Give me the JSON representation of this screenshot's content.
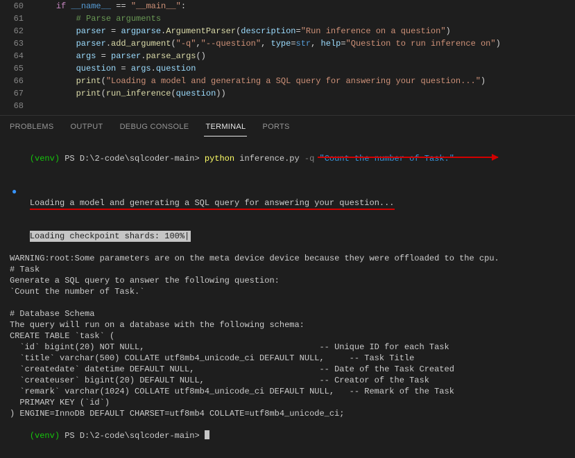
{
  "editor": {
    "lines": [
      {
        "num": "60",
        "indent": 1,
        "tokens": [
          [
            "keyword",
            "if"
          ],
          [
            "plain",
            " "
          ],
          [
            "builtin",
            "__name__"
          ],
          [
            "plain",
            " "
          ],
          [
            "operator",
            "=="
          ],
          [
            "plain",
            " "
          ],
          [
            "string",
            "\"__main__\""
          ],
          [
            "plain",
            ":"
          ]
        ]
      },
      {
        "num": "61",
        "indent": 2,
        "tokens": [
          [
            "comment",
            "# Parse arguments"
          ]
        ]
      },
      {
        "num": "62",
        "indent": 2,
        "tokens": [
          [
            "variable",
            "parser"
          ],
          [
            "plain",
            " "
          ],
          [
            "operator",
            "="
          ],
          [
            "plain",
            " "
          ],
          [
            "variable",
            "argparse"
          ],
          [
            "plain",
            "."
          ],
          [
            "function",
            "ArgumentParser"
          ],
          [
            "paren",
            "("
          ],
          [
            "variable",
            "description"
          ],
          [
            "operator",
            "="
          ],
          [
            "string",
            "\"Run inference on a question\""
          ],
          [
            "paren",
            ")"
          ]
        ]
      },
      {
        "num": "63",
        "indent": 2,
        "tokens": [
          [
            "variable",
            "parser"
          ],
          [
            "plain",
            "."
          ],
          [
            "function",
            "add_argument"
          ],
          [
            "paren",
            "("
          ],
          [
            "string",
            "\"-q\""
          ],
          [
            "plain",
            ","
          ],
          [
            "string",
            "\"--question\""
          ],
          [
            "plain",
            ", "
          ],
          [
            "variable",
            "type"
          ],
          [
            "operator",
            "="
          ],
          [
            "builtin",
            "str"
          ],
          [
            "plain",
            ", "
          ],
          [
            "variable",
            "help"
          ],
          [
            "operator",
            "="
          ],
          [
            "string",
            "\"Question to run inference on\""
          ],
          [
            "paren",
            ")"
          ]
        ]
      },
      {
        "num": "64",
        "indent": 2,
        "tokens": [
          [
            "variable",
            "args"
          ],
          [
            "plain",
            " "
          ],
          [
            "operator",
            "="
          ],
          [
            "plain",
            " "
          ],
          [
            "variable",
            "parser"
          ],
          [
            "plain",
            "."
          ],
          [
            "function",
            "parse_args"
          ],
          [
            "paren",
            "()"
          ]
        ]
      },
      {
        "num": "65",
        "indent": 2,
        "tokens": [
          [
            "variable",
            "question"
          ],
          [
            "plain",
            " "
          ],
          [
            "operator",
            "="
          ],
          [
            "plain",
            " "
          ],
          [
            "variable",
            "args"
          ],
          [
            "plain",
            "."
          ],
          [
            "variable",
            "question"
          ]
        ]
      },
      {
        "num": "66",
        "indent": 2,
        "tokens": [
          [
            "function",
            "print"
          ],
          [
            "paren",
            "("
          ],
          [
            "string",
            "\"Loading a model and generating a SQL query for answering your question...\""
          ],
          [
            "paren",
            ")"
          ]
        ]
      },
      {
        "num": "67",
        "indent": 2,
        "tokens": [
          [
            "function",
            "print"
          ],
          [
            "paren",
            "("
          ],
          [
            "function",
            "run_inference"
          ],
          [
            "paren",
            "("
          ],
          [
            "variable",
            "question"
          ],
          [
            "paren",
            "))"
          ]
        ]
      },
      {
        "num": "68",
        "indent": 0,
        "tokens": []
      }
    ]
  },
  "panel": {
    "tabs": [
      "PROBLEMS",
      "OUTPUT",
      "DEBUG CONSOLE",
      "TERMINAL",
      "PORTS"
    ],
    "active": 3
  },
  "terminal": {
    "prompt1": {
      "venv": "(venv)",
      "path": "PS D:\\2-code\\sqlcoder-main>",
      "cmd": "python",
      "script": "inference.py",
      "flag": "-q",
      "arg": "\"Count the number of Task.\""
    },
    "loading_line": "Loading a model and generating a SQL query for answering your question...",
    "shards_line": "Loading checkpoint shards: 100%|",
    "lines": [
      "WARNING:root:Some parameters are on the meta device device because they were offloaded to the cpu.",
      "# Task",
      "Generate a SQL query to answer the following question:",
      "`Count the number of Task.`",
      "",
      "# Database Schema",
      "The query will run on a database with the following schema:",
      "CREATE TABLE `task` (",
      "  `id` bigint(20) NOT NULL,                                   -- Unique ID for each Task",
      "  `title` varchar(500) COLLATE utf8mb4_unicode_ci DEFAULT NULL,     -- Task Title",
      "  `createdate` datetime DEFAULT NULL,                         -- Date of the Task Created",
      "  `createuser` bigint(20) DEFAULT NULL,                       -- Creator of the Task",
      "  `remark` varchar(1024) COLLATE utf8mb4_unicode_ci DEFAULT NULL,   -- Remark of the Task",
      "  PRIMARY KEY (`id`)",
      ") ENGINE=InnoDB DEFAULT CHARSET=utf8mb4 COLLATE=utf8mb4_unicode_ci;"
    ],
    "prompt2": {
      "venv": "(venv)",
      "path": "PS D:\\2-code\\sqlcoder-main>"
    }
  }
}
